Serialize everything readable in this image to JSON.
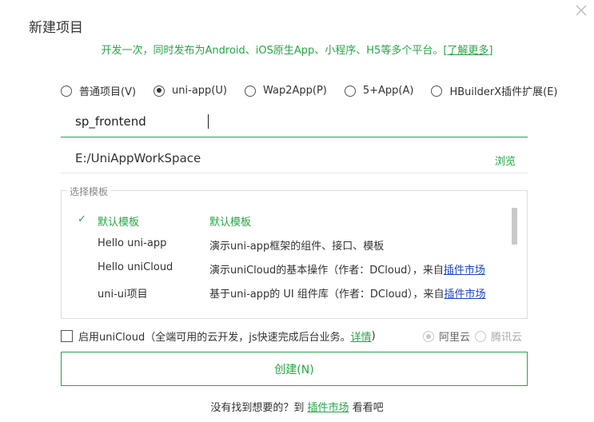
{
  "dialog": {
    "title": "新建项目",
    "subtitle": "开发一次，同时发布为Android、iOS原生App、小程序、H5等多个平台。",
    "learn_more": "[了解更多]"
  },
  "project_types": [
    {
      "label": "普通项目(V)",
      "selected": false
    },
    {
      "label": "uni-app(U)",
      "selected": true
    },
    {
      "label": "Wap2App(P)",
      "selected": false
    },
    {
      "label": "5+App(A)",
      "selected": false
    },
    {
      "label": "HBuilderX插件扩展(E)",
      "selected": false
    }
  ],
  "project_name": {
    "value": "sp_frontend"
  },
  "location": {
    "value": "E:/UniAppWorkSpace",
    "browse_label": "浏览"
  },
  "template": {
    "legend": "选择模板",
    "items": [
      {
        "name": "默认模板",
        "desc": "默认模板",
        "link": "",
        "selected": true,
        "check": "✓"
      },
      {
        "name": "Hello uni-app",
        "desc": "演示uni-app框架的组件、接口、模板",
        "link": "",
        "selected": false
      },
      {
        "name": "Hello uniCloud",
        "desc": "演示uniCloud的基本操作（作者：DCloud），来自",
        "link": "插件市场",
        "selected": false
      },
      {
        "name": "uni-ui项目",
        "desc": "基于uni-app的 UI 组件库（作者：DCloud），来自",
        "link": "插件市场",
        "selected": false
      }
    ]
  },
  "unicloud": {
    "label": "启用uniCloud（全端可用的云开发，js快速完成后台业务。",
    "detail": "详情",
    "close_paren": ")",
    "checked": false,
    "providers": [
      {
        "label": "阿里云",
        "selected": true
      },
      {
        "label": "腾讯云",
        "selected": false
      }
    ]
  },
  "create_button": "创建(N)",
  "footer": {
    "prefix": "没有找到想要的？到",
    "market": "插件市场",
    "suffix": "看看吧"
  },
  "colors": {
    "accent": "#25a745",
    "link": "#1a45c8"
  }
}
